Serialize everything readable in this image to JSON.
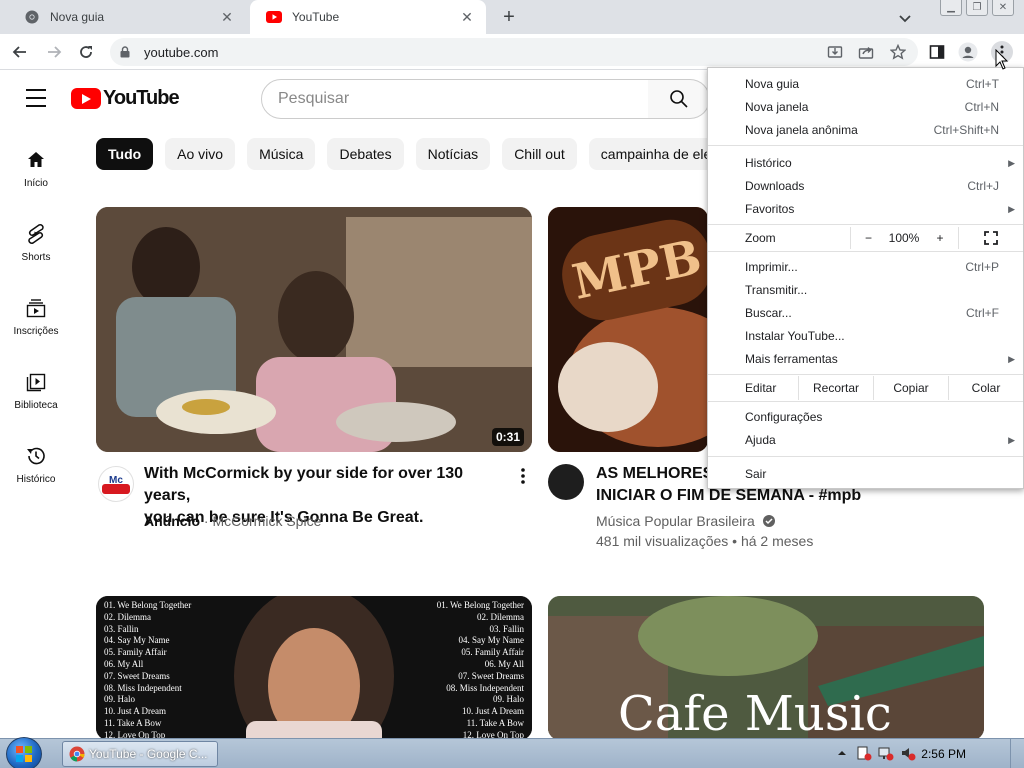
{
  "browser": {
    "tabs": [
      {
        "title": "Nova guia",
        "active": false,
        "icon": "chrome-icon"
      },
      {
        "title": "YouTube",
        "active": true,
        "icon": "youtube-icon"
      }
    ],
    "url": "youtube.com"
  },
  "youtube": {
    "logo_text": "YouTube",
    "search_placeholder": "Pesquisar",
    "chips": [
      "Tudo",
      "Ao vivo",
      "Música",
      "Debates",
      "Notícias",
      "Chill out",
      "campainha de ele"
    ],
    "sidebar": [
      {
        "label": "Início",
        "icon": "home-icon"
      },
      {
        "label": "Shorts",
        "icon": "shorts-icon"
      },
      {
        "label": "Inscrições",
        "icon": "subscriptions-icon"
      },
      {
        "label": "Biblioteca",
        "icon": "library-icon"
      },
      {
        "label": "Histórico",
        "icon": "history-icon"
      }
    ],
    "videos": [
      {
        "title_line1": "With McCormick by your side for over 130 years,",
        "title_line2": "you can be sure It's Gonna Be Great.",
        "badge": "Anúncio",
        "channel": "McCormick Spice",
        "duration": "0:31"
      },
      {
        "title_line1": "AS MELHORES",
        "title_line2": "INICIAR O FIM DE SEMANA - #mpb",
        "channel": "Música Popular Brasileira",
        "stats": "481 mil visualizações • há 2 meses",
        "thumb_text": "MPB"
      },
      {
        "tracklist": [
          "01. We Belong Together",
          "02. Dilemma",
          "03. Fallin",
          "04. Say My Name",
          "05. Family Affair",
          "06. My All",
          "07. Sweet Dreams",
          "08. Miss Independent",
          "09. Halo",
          "10. Just A Dream",
          "11. Take A Bow",
          "12. Love On Top"
        ]
      },
      {
        "thumb_text": "Cafe Music"
      }
    ]
  },
  "menu": {
    "items_1": [
      {
        "label": "Nova guia",
        "shortcut": "Ctrl+T"
      },
      {
        "label": "Nova janela",
        "shortcut": "Ctrl+N"
      },
      {
        "label": "Nova janela anônima",
        "shortcut": "Ctrl+Shift+N"
      }
    ],
    "items_2": [
      {
        "label": "Histórico",
        "shortcut": ""
      },
      {
        "label": "Downloads",
        "shortcut": "Ctrl+J"
      },
      {
        "label": "Favoritos",
        "shortcut": ""
      }
    ],
    "zoom": {
      "label": "Zoom",
      "minus": "−",
      "value": "100%",
      "plus": "+"
    },
    "items_3": [
      {
        "label": "Imprimir...",
        "shortcut": "Ctrl+P"
      },
      {
        "label": "Transmitir...",
        "shortcut": ""
      },
      {
        "label": "Buscar...",
        "shortcut": "Ctrl+F"
      },
      {
        "label": "Instalar YouTube...",
        "shortcut": ""
      },
      {
        "label": "Mais ferramentas",
        "shortcut": ""
      }
    ],
    "edit": {
      "label": "Editar",
      "cut": "Recortar",
      "copy": "Copiar",
      "paste": "Colar"
    },
    "items_4": [
      {
        "label": "Configurações"
      },
      {
        "label": "Ajuda"
      }
    ],
    "exit": "Sair"
  },
  "taskbar": {
    "task_title": "YouTube - Google C...",
    "clock": "2:56 PM"
  },
  "colors": {
    "yt_red": "#ff0000",
    "chrome_bg": "#dee1e6",
    "taskbar": "#a9bcd1"
  }
}
